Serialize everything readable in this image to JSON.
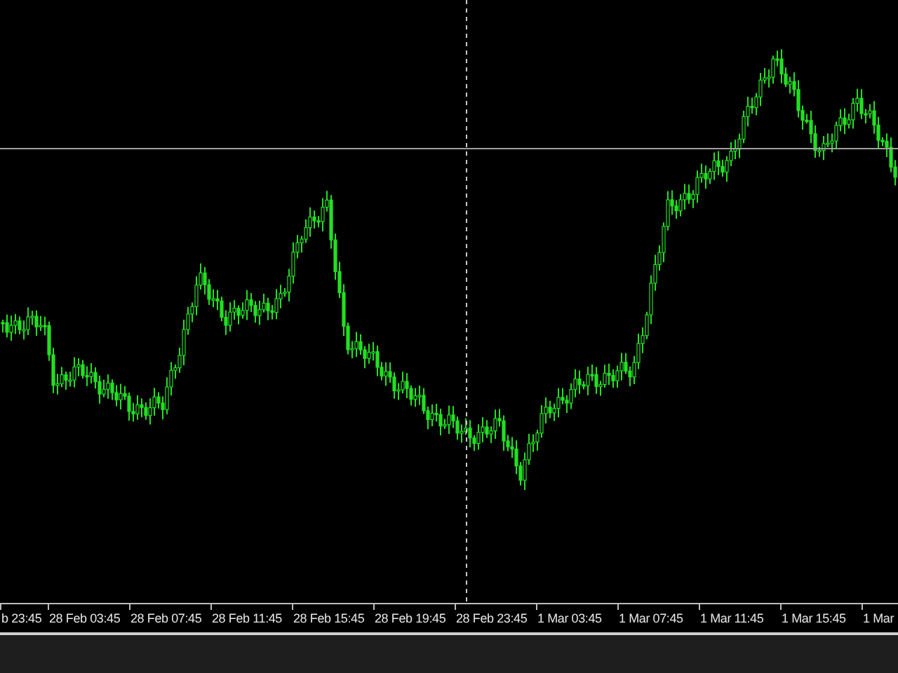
{
  "time_axis": {
    "labels": [
      "b 23:45",
      "28 Feb 03:45",
      "28 Feb 07:45",
      "28 Feb 11:45",
      "28 Feb 15:45",
      "28 Feb 19:45",
      "28 Feb 23:45",
      "1 Mar 03:45",
      "1 Mar 07:45",
      "1 Mar 11:45",
      "1 Mar 15:45",
      "1 Mar"
    ]
  }
}
